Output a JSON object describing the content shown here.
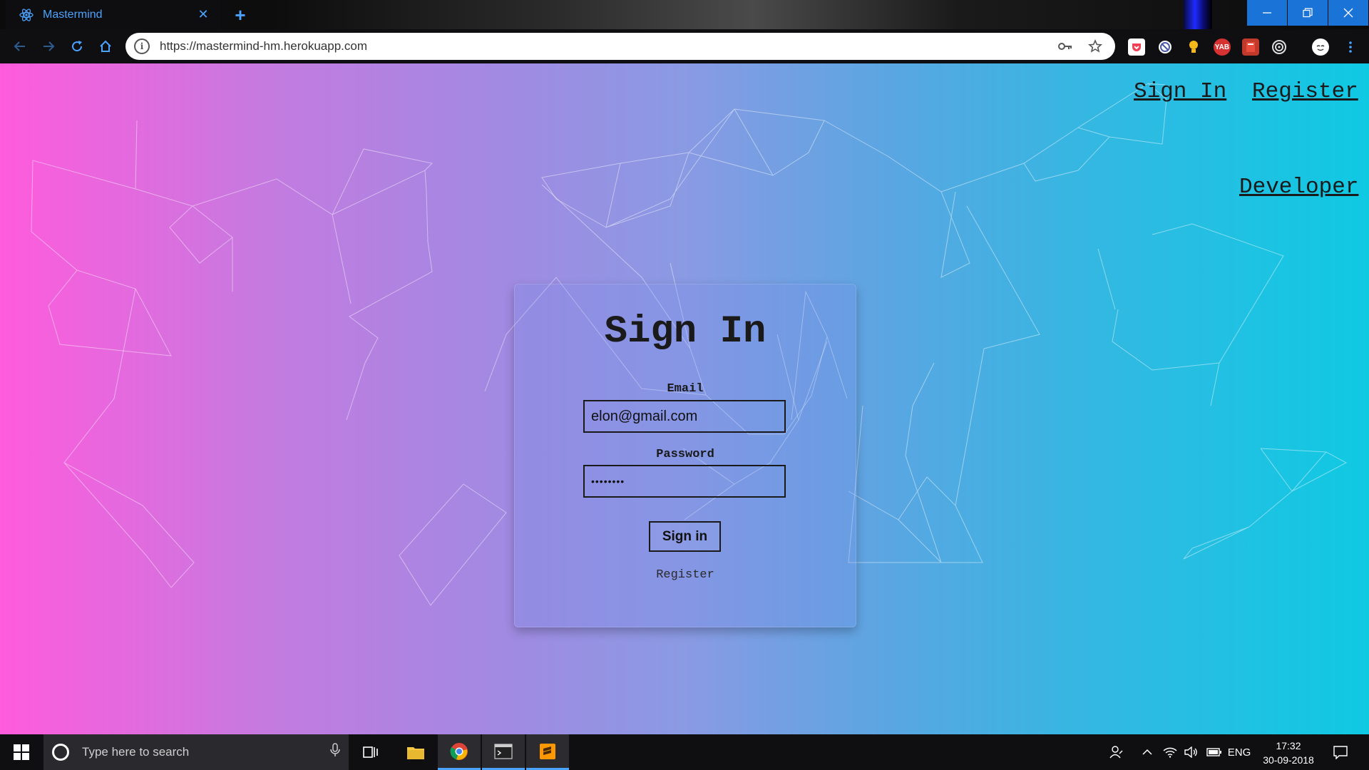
{
  "browser": {
    "tab_title": "Mastermind",
    "url": "https://mastermind-hm.herokuapp.com",
    "new_tab_symbol": "+",
    "tab_close_symbol": "✕",
    "extensions": [
      "pocket-icon",
      "blocker-icon",
      "lightbulb-icon",
      "yab-icon",
      "book-icon",
      "target-icon"
    ],
    "extension_yab_label": "YAB"
  },
  "page": {
    "nav": {
      "signin_label": "Sign In",
      "register_label": "Register",
      "developer_label": "Developer"
    },
    "form": {
      "title": "Sign In",
      "email_label": "Email",
      "email_value": "elon@gmail.com",
      "password_label": "Password",
      "password_value": "••••••••",
      "submit_label": "Sign in",
      "register_link": "Register"
    },
    "colors": {
      "gradient_left": "#ff5bdc",
      "gradient_right": "#0fc9e3",
      "accent": "#4aa3ff"
    }
  },
  "taskbar": {
    "search_placeholder": "Type here to search",
    "language": "ENG",
    "time": "17:32",
    "date": "30-09-2018"
  }
}
